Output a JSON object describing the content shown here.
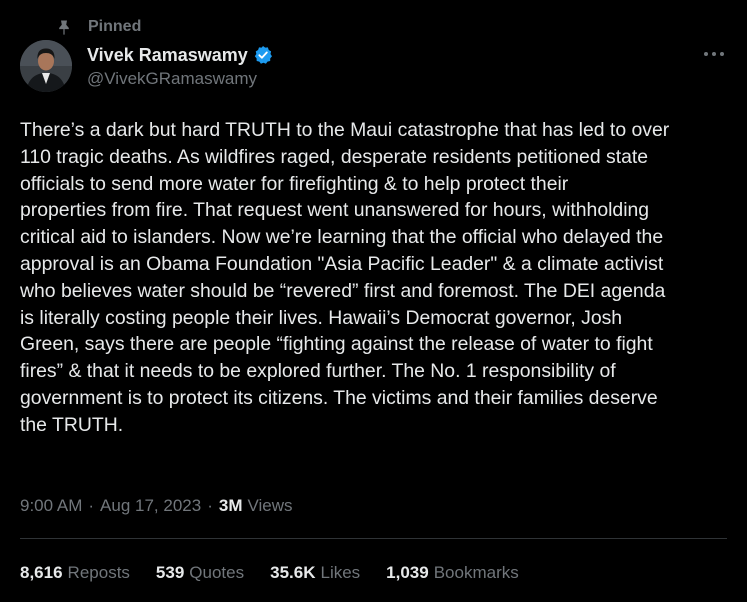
{
  "pinned": {
    "label": "Pinned",
    "icon": "pin-icon"
  },
  "author": {
    "display_name": "Vivek Ramaswamy",
    "handle": "@VivekGRamaswamy",
    "verified_icon": "verified-badge-icon",
    "verified_color": "#1d9bf0",
    "avatar": "avatar"
  },
  "more_icon": "more-horizontal-icon",
  "tweet": {
    "text_lines": [
      "There’s a dark but hard TRUTH to the Maui catastrophe that has led to over",
      "110 tragic deaths. As wildfires raged, desperate residents petitioned state",
      "officials to send more water for firefighting & to help protect their",
      "properties from fire. That request went unanswered for hours, withholding",
      "critical aid to islanders. Now we’re learning that the official who delayed the",
      "approval is an Obama Foundation \"Asia Pacific Leader\" & a climate activist",
      "who believes water should be “revered” first and foremost. The DEI agenda",
      "is literally costing people their lives. Hawaii’s Democrat governor, Josh",
      "Green, says there are people “fighting against the release of water to fight",
      "fires” & that it needs to be explored further. The No. 1 responsibility of",
      "government is to protect its citizens. The victims and their families deserve",
      "the TRUTH."
    ]
  },
  "meta": {
    "time": "9:00 AM",
    "separator": "·",
    "date": "Aug 17, 2023",
    "views_count": "3M",
    "views_label": "Views"
  },
  "stats": {
    "reposts": {
      "count": "8,616",
      "label": "Reposts"
    },
    "quotes": {
      "count": "539",
      "label": "Quotes"
    },
    "likes": {
      "count": "35.6K",
      "label": "Likes"
    },
    "bookmarks": {
      "count": "1,039",
      "label": "Bookmarks"
    }
  },
  "colors": {
    "background": "#000000",
    "primary_text": "#e7e9ea",
    "secondary_text": "#71767b",
    "divider": "#2f3336",
    "accent": "#1d9bf0"
  }
}
